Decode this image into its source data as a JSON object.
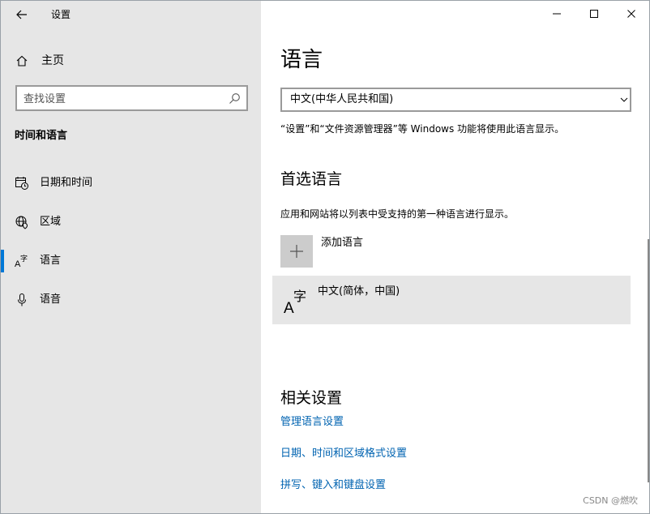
{
  "window": {
    "app_title": "设置",
    "controls": [
      "minimize",
      "maximize",
      "close"
    ]
  },
  "sidebar": {
    "home_label": "主页",
    "search_placeholder": "查找设置",
    "section_header": "时间和语言",
    "items": [
      {
        "label": "日期和时间",
        "icon": "clock-calendar-icon",
        "selected": false
      },
      {
        "label": "区域",
        "icon": "globe-region-icon",
        "selected": false
      },
      {
        "label": "语言",
        "icon": "language-icon",
        "selected": true
      },
      {
        "label": "语音",
        "icon": "microphone-icon",
        "selected": false
      }
    ]
  },
  "main": {
    "title": "语言",
    "display_language": "中文(中华人民共和国)",
    "display_note": "“设置”和“文件资源管理器”等 Windows 功能将使用此语言显示。",
    "preferred_heading": "首选语言",
    "preferred_desc": "应用和网站将以列表中受支持的第一种语言进行显示。",
    "add_language_label": "添加语言",
    "languages": [
      {
        "label": "中文(简体，中国)",
        "icon": "language-icon"
      }
    ],
    "related_heading": "相关设置",
    "related_links": [
      "管理语言设置",
      "日期、时间和区域格式设置",
      "拼写、键入和键盘设置"
    ]
  },
  "watermark": "CSDN @燃吹",
  "colors": {
    "accent": "#0078d7",
    "link": "#0063b1",
    "sidebar_bg": "#e6e6e6"
  }
}
